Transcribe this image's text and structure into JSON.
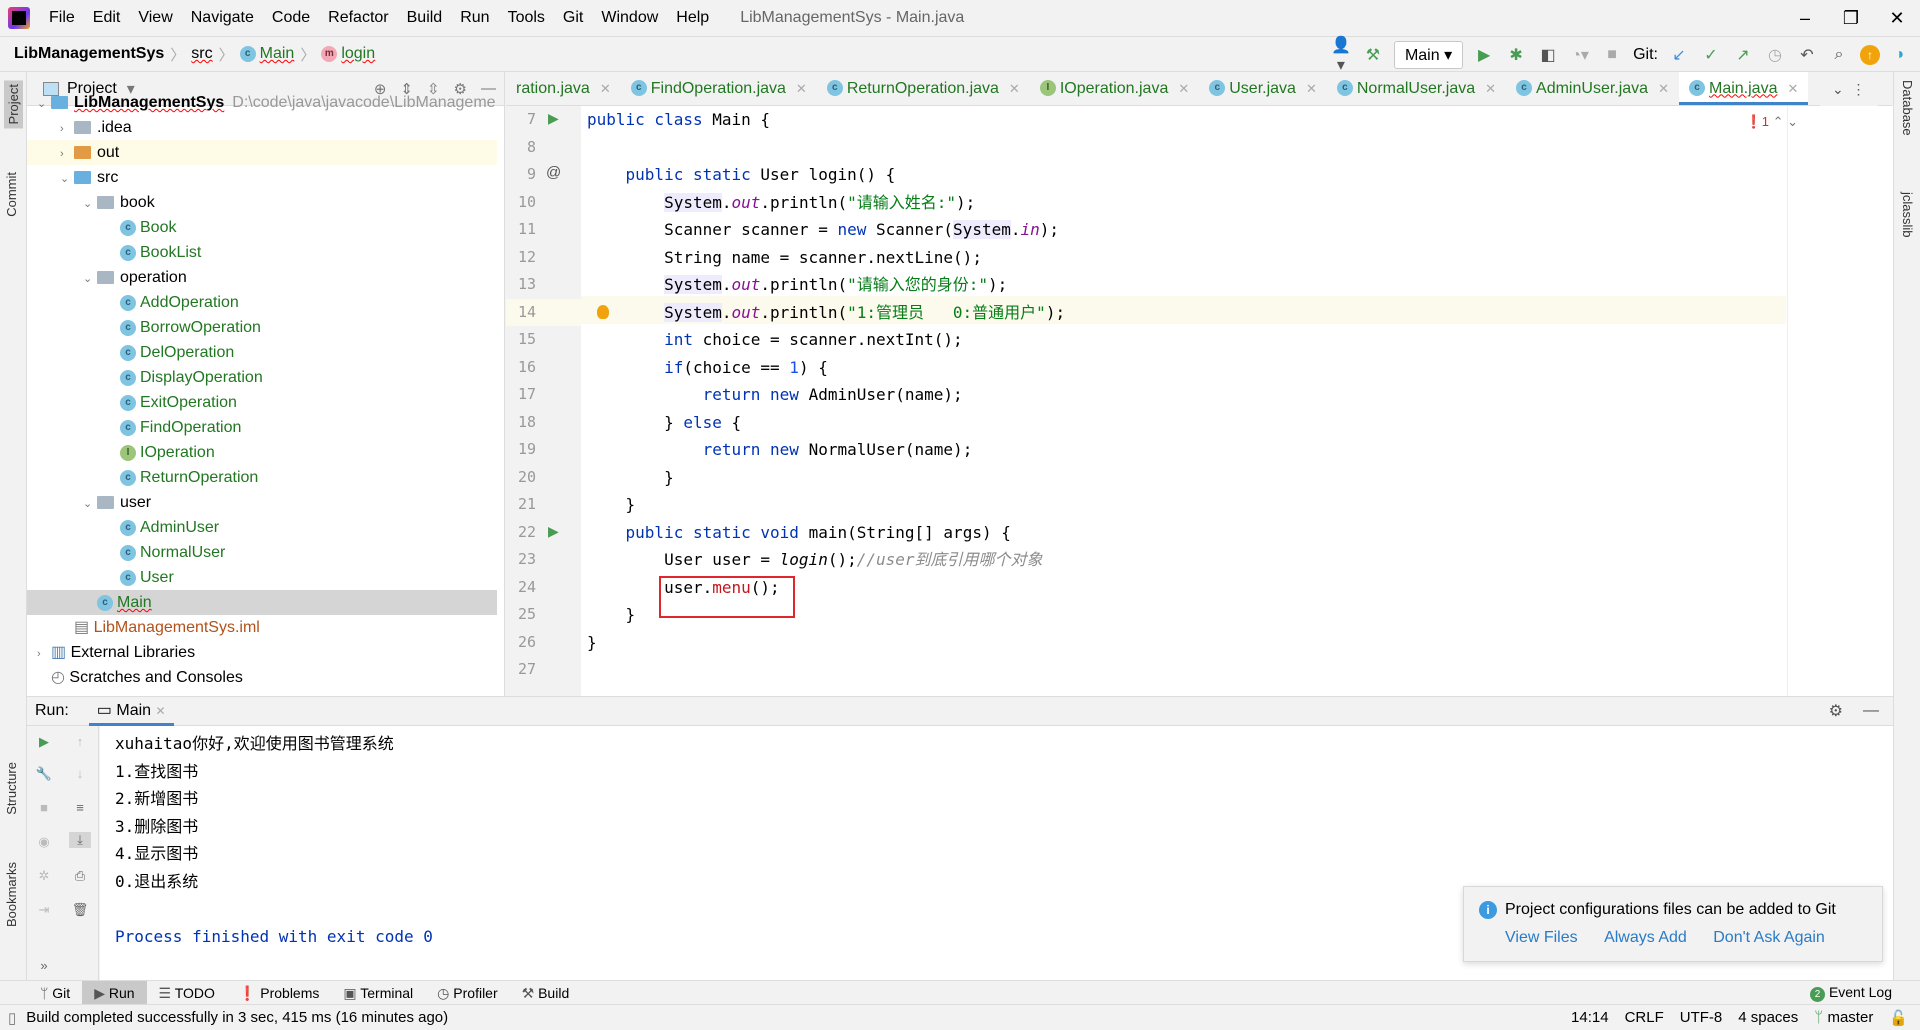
{
  "menubar": {
    "items": [
      "File",
      "Edit",
      "View",
      "Navigate",
      "Code",
      "Refactor",
      "Build",
      "Run",
      "Tools",
      "Git",
      "Window",
      "Help"
    ],
    "window_title": "LibManagementSys - Main.java"
  },
  "navbar": {
    "project": "LibManagementSys",
    "src": "src",
    "class": "Main",
    "method": "login",
    "run_config": "Main",
    "git_label": "Git:"
  },
  "project_panel": {
    "title": "Project",
    "root_path": "D:\\code\\java\\javacode\\LibManageme",
    "tree": [
      {
        "label": "LibManagementSys",
        "depth": 0,
        "kind": "module",
        "chev": "v",
        "bold": true
      },
      {
        "label": ".idea",
        "depth": 1,
        "kind": "folder",
        "chev": ">"
      },
      {
        "label": "out",
        "depth": 1,
        "kind": "folder-orange",
        "chev": ">",
        "hl": true
      },
      {
        "label": "src",
        "depth": 1,
        "kind": "folder-blue",
        "chev": "v"
      },
      {
        "label": "book",
        "depth": 2,
        "kind": "folder",
        "chev": "v"
      },
      {
        "label": "Book",
        "depth": 3,
        "kind": "class"
      },
      {
        "label": "BookList",
        "depth": 3,
        "kind": "class"
      },
      {
        "label": "operation",
        "depth": 2,
        "kind": "folder",
        "chev": "v"
      },
      {
        "label": "AddOperation",
        "depth": 3,
        "kind": "class"
      },
      {
        "label": "BorrowOperation",
        "depth": 3,
        "kind": "class"
      },
      {
        "label": "DelOperation",
        "depth": 3,
        "kind": "class"
      },
      {
        "label": "DisplayOperation",
        "depth": 3,
        "kind": "class"
      },
      {
        "label": "ExitOperation",
        "depth": 3,
        "kind": "class"
      },
      {
        "label": "FindOperation",
        "depth": 3,
        "kind": "class"
      },
      {
        "label": "IOperation",
        "depth": 3,
        "kind": "interface"
      },
      {
        "label": "ReturnOperation",
        "depth": 3,
        "kind": "class"
      },
      {
        "label": "user",
        "depth": 2,
        "kind": "folder",
        "chev": "v"
      },
      {
        "label": "AdminUser",
        "depth": 3,
        "kind": "class"
      },
      {
        "label": "NormalUser",
        "depth": 3,
        "kind": "class"
      },
      {
        "label": "User",
        "depth": 3,
        "kind": "class"
      },
      {
        "label": "Main",
        "depth": 2,
        "kind": "class",
        "sel": true
      },
      {
        "label": "LibManagementSys.iml",
        "depth": 1,
        "kind": "iml"
      },
      {
        "label": "External Libraries",
        "depth": 0,
        "kind": "lib",
        "chev": ">"
      },
      {
        "label": "Scratches and Consoles",
        "depth": 0,
        "kind": "scratch"
      }
    ]
  },
  "editor": {
    "tabs": [
      {
        "label": "ration.java",
        "icon": "none"
      },
      {
        "label": "FindOperation.java",
        "icon": "c"
      },
      {
        "label": "ReturnOperation.java",
        "icon": "c"
      },
      {
        "label": "IOperation.java",
        "icon": "i"
      },
      {
        "label": "User.java",
        "icon": "c"
      },
      {
        "label": "NormalUser.java",
        "icon": "c"
      },
      {
        "label": "AdminUser.java",
        "icon": "c"
      },
      {
        "label": "Main.java",
        "icon": "c",
        "active": true
      }
    ],
    "error_count": "1",
    "lines": [
      {
        "n": "7",
        "run": true,
        "tokens": [
          [
            "public class ",
            "kw"
          ],
          [
            "Main ",
            ""
          ],
          [
            "{",
            ""
          ]
        ]
      },
      {
        "n": "8",
        "tokens": []
      },
      {
        "n": "9",
        "at": true,
        "tokens": [
          [
            "    public static ",
            "kw"
          ],
          [
            "User ",
            ""
          ],
          [
            "login",
            ""
          ],
          [
            "() {",
            ""
          ]
        ]
      },
      {
        "n": "10",
        "tokens": [
          [
            "        ",
            ""
          ],
          [
            "System",
            "sys"
          ],
          [
            ".",
            ""
          ],
          [
            "out",
            "fld"
          ],
          [
            ".println(",
            ""
          ],
          [
            "\"请输入姓名:\"",
            "str"
          ],
          [
            ");",
            ""
          ]
        ]
      },
      {
        "n": "11",
        "tokens": [
          [
            "        Scanner scanner = ",
            ""
          ],
          [
            "new ",
            "kw"
          ],
          [
            "Scanner(",
            ""
          ],
          [
            "System",
            "sys"
          ],
          [
            ".",
            ""
          ],
          [
            "in",
            "fld"
          ],
          [
            ");",
            ""
          ]
        ]
      },
      {
        "n": "12",
        "tokens": [
          [
            "        String name = scanner.nextLine();",
            ""
          ]
        ]
      },
      {
        "n": "13",
        "tokens": [
          [
            "        ",
            ""
          ],
          [
            "System",
            "sys"
          ],
          [
            ".",
            ""
          ],
          [
            "out",
            "fld"
          ],
          [
            ".println(",
            ""
          ],
          [
            "\"请输入您的身份:\"",
            "str"
          ],
          [
            ");",
            ""
          ]
        ]
      },
      {
        "n": "14",
        "bulb": true,
        "current": true,
        "tokens": [
          [
            "        ",
            ""
          ],
          [
            "System",
            "sys"
          ],
          [
            ".",
            ""
          ],
          [
            "out",
            "fld"
          ],
          [
            ".println(",
            ""
          ],
          [
            "\"1:管理员   0:普通用户\"",
            "str"
          ],
          [
            ");",
            ""
          ]
        ]
      },
      {
        "n": "15",
        "tokens": [
          [
            "        ",
            ""
          ],
          [
            "int ",
            "kw"
          ],
          [
            "choice = scanner.nextInt();",
            ""
          ]
        ]
      },
      {
        "n": "16",
        "tokens": [
          [
            "        ",
            ""
          ],
          [
            "if",
            "kw"
          ],
          [
            "(choice == ",
            ""
          ],
          [
            "1",
            "num"
          ],
          [
            ") {",
            ""
          ]
        ]
      },
      {
        "n": "17",
        "tokens": [
          [
            "            ",
            ""
          ],
          [
            "return new ",
            "kw"
          ],
          [
            "AdminUser(name);",
            ""
          ]
        ]
      },
      {
        "n": "18",
        "tokens": [
          [
            "        } ",
            ""
          ],
          [
            "else ",
            "kw"
          ],
          [
            "{",
            ""
          ]
        ]
      },
      {
        "n": "19",
        "tokens": [
          [
            "            ",
            ""
          ],
          [
            "return new ",
            "kw"
          ],
          [
            "NormalUser(name);",
            ""
          ]
        ]
      },
      {
        "n": "20",
        "tokens": [
          [
            "        }",
            ""
          ]
        ]
      },
      {
        "n": "21",
        "tokens": [
          [
            "    }",
            ""
          ]
        ]
      },
      {
        "n": "22",
        "run": true,
        "tokens": [
          [
            "    public static void ",
            "kw"
          ],
          [
            "main(String[] args) {",
            ""
          ]
        ]
      },
      {
        "n": "23",
        "tokens": [
          [
            "        User user = ",
            ""
          ],
          [
            "login",
            "st"
          ],
          [
            "();",
            ""
          ],
          [
            "//user到底引用哪个对象",
            "cmt"
          ]
        ]
      },
      {
        "n": "24",
        "tokens": [
          [
            "        user.",
            ""
          ],
          [
            "menu",
            "err"
          ],
          [
            "();",
            ""
          ]
        ]
      },
      {
        "n": "25",
        "tokens": [
          [
            "    }",
            ""
          ]
        ]
      },
      {
        "n": "26",
        "tokens": [
          [
            "}",
            ""
          ]
        ]
      },
      {
        "n": "27",
        "tokens": []
      }
    ]
  },
  "run_panel": {
    "label": "Run:",
    "tab": "Main",
    "output": [
      "xuhaitao你好,欢迎使用图书管理系统",
      "1.查找图书",
      "2.新增图书",
      "3.删除图书",
      "4.显示图书",
      "0.退出系统",
      "",
      "Process finished with exit code 0"
    ]
  },
  "notification": {
    "message": "Project configurations files can be added to Git",
    "actions": [
      "View Files",
      "Always Add",
      "Don't Ask Again"
    ]
  },
  "bottom_tools": [
    {
      "label": "Git",
      "icon": "git-icon"
    },
    {
      "label": "Run",
      "icon": "play-icon",
      "active": true
    },
    {
      "label": "TODO",
      "icon": "list-icon"
    },
    {
      "label": "Problems",
      "icon": "problems-icon"
    },
    {
      "label": "Terminal",
      "icon": "terminal-icon"
    },
    {
      "label": "Profiler",
      "icon": "profiler-icon"
    },
    {
      "label": "Build",
      "icon": "hammer-icon"
    }
  ],
  "event_log": {
    "label": "Event Log",
    "count": "2"
  },
  "statusbar": {
    "message": "Build completed successfully in 3 sec, 415 ms (16 minutes ago)",
    "position": "14:14",
    "line_sep": "CRLF",
    "encoding": "UTF-8",
    "indent": "4 spaces",
    "branch": "master"
  },
  "side_labels": {
    "project": "Project",
    "commit": "Commit",
    "structure": "Structure",
    "bookmarks": "Bookmarks",
    "database": "Database",
    "jclasslib": "jclasslib"
  },
  "colors": {
    "accent": "#4083c9",
    "keyword": "#0033b3",
    "string": "#067d17",
    "error": "#e0262d"
  }
}
